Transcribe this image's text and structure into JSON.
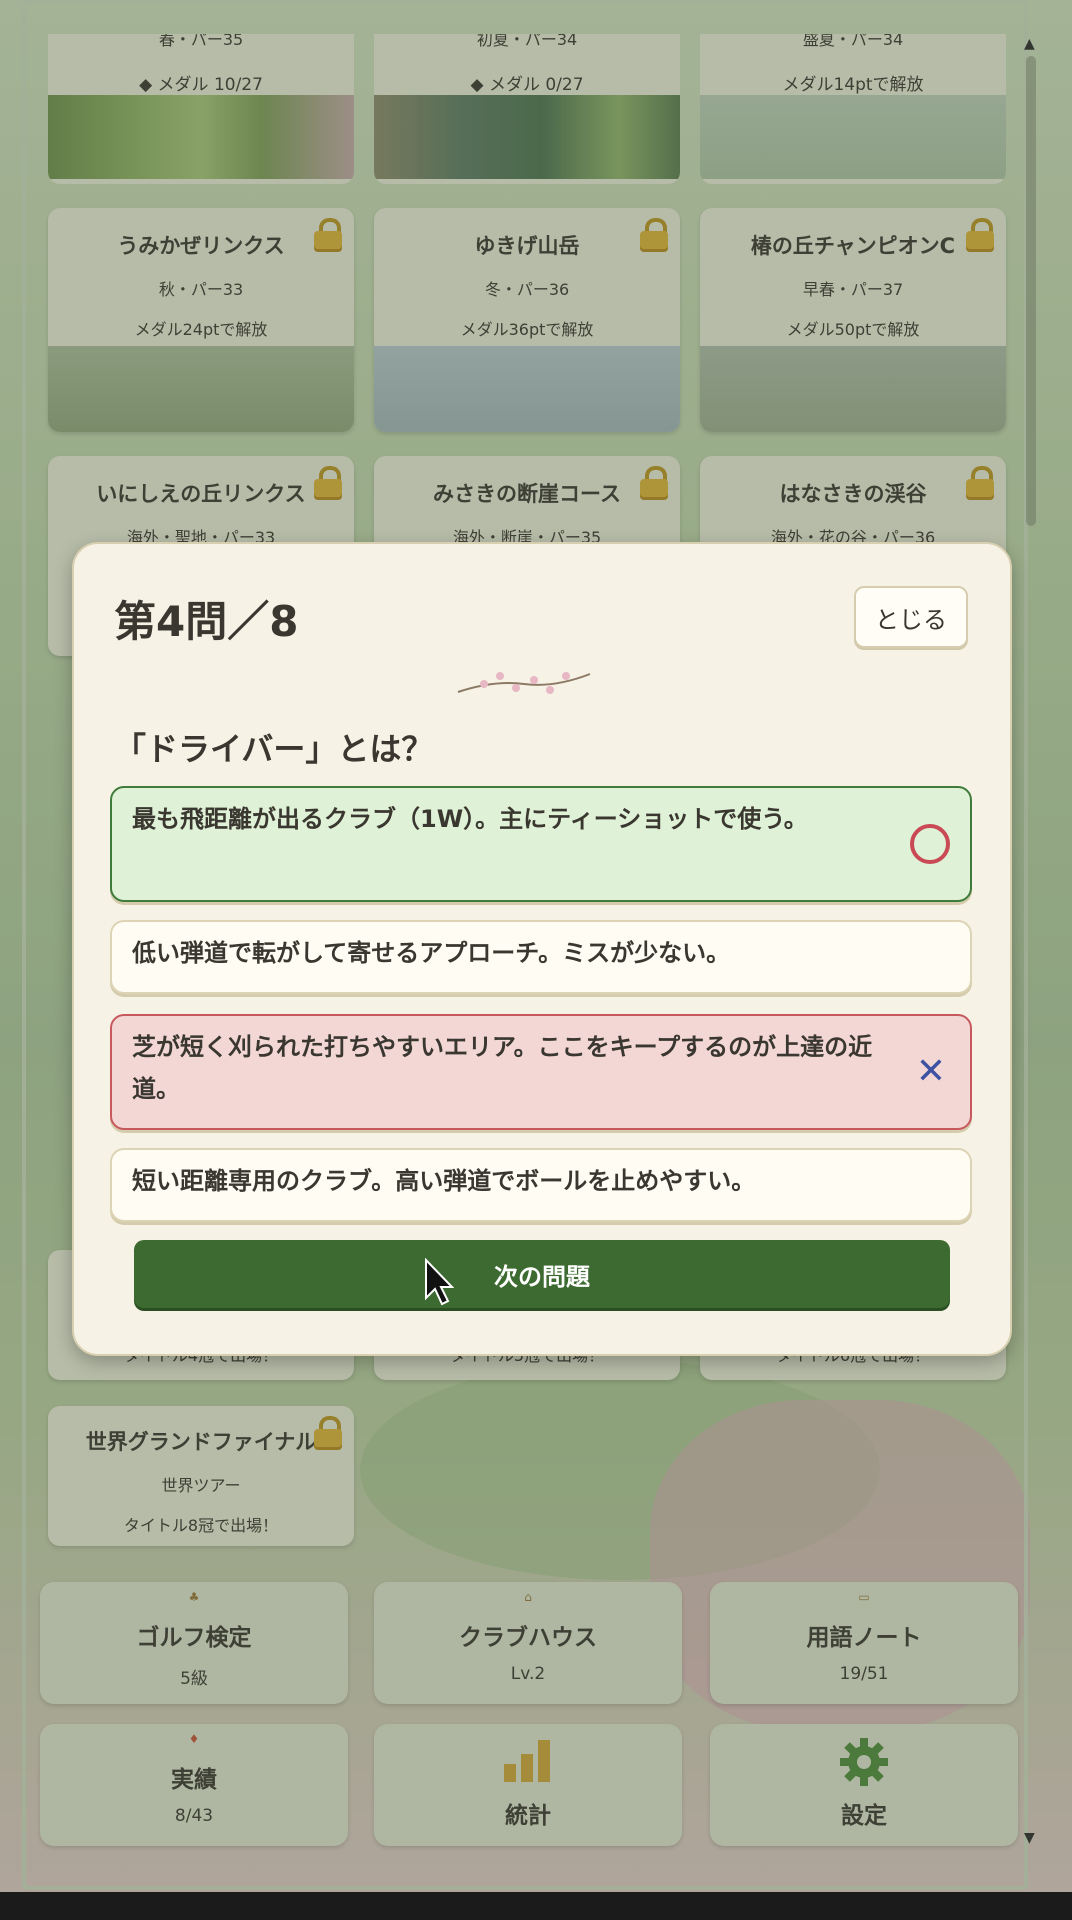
{
  "top_cards": [
    {
      "sub": "春・パー35",
      "status": "◆ メダル 10/27"
    },
    {
      "sub": "初夏・パー34",
      "status": "◆ メダル 0/27"
    },
    {
      "sub": "盛夏・パー34",
      "status": "メダル14ptで解放"
    }
  ],
  "courses_row1": [
    {
      "name": "うみかぜリンクス",
      "sub": "秋・パー33",
      "unlock": "メダル24ptで解放"
    },
    {
      "name": "ゆきげ山岳",
      "sub": "冬・パー36",
      "unlock": "メダル36ptで解放"
    },
    {
      "name": "椿の丘チャンピオンC",
      "sub": "早春・パー37",
      "unlock": "メダル50ptで解放"
    }
  ],
  "courses_row2": [
    {
      "name": "いにしえの丘リンクス",
      "sub": "海外・聖地・パー33"
    },
    {
      "name": "みさきの断崖コース",
      "sub": "海外・断崖・パー35"
    },
    {
      "name": "はなさきの渓谷",
      "sub": "海外・花の谷・パー36"
    }
  ],
  "tour_row": [
    {
      "unlock": "タイトル4冠で出場！"
    },
    {
      "unlock": "タイトル5冠で出場！"
    },
    {
      "unlock": "タイトル6冠で出場！"
    }
  ],
  "final_card": {
    "name": "世界グランドファイナル",
    "sub": "世界ツアー",
    "unlock": "タイトル8冠で出場！"
  },
  "menu": [
    {
      "label": "ゴルフ検定",
      "value": "5級"
    },
    {
      "label": "クラブハウス",
      "value": "Lv.2"
    },
    {
      "label": "用語ノート",
      "value": "19/51"
    },
    {
      "label": "実績",
      "value": "8/43"
    },
    {
      "label": "統計"
    },
    {
      "label": "設定"
    }
  ],
  "quiz": {
    "title": "第4問／8",
    "close_label": "とじる",
    "question": "「ドライバー」とは？",
    "options": [
      {
        "text": "最も飛距離が出るクラブ（1W）。主にティーショットで使う。",
        "state": "correct"
      },
      {
        "text": "低い弾道で転がして寄せるアプローチ。ミスが少ない。",
        "state": "normal"
      },
      {
        "text": "芝が短く刈られた打ちやすいエリア。ここをキープするのが上達の近道。",
        "state": "wrong"
      },
      {
        "text": "短い距離専用のクラブ。高い弾道でボールを止めやすい。",
        "state": "normal"
      }
    ],
    "next_label": "次の問題"
  },
  "colors": {
    "correct": "#3f7c3c",
    "wrong": "#c7595e",
    "accent": "#3c6a30"
  }
}
